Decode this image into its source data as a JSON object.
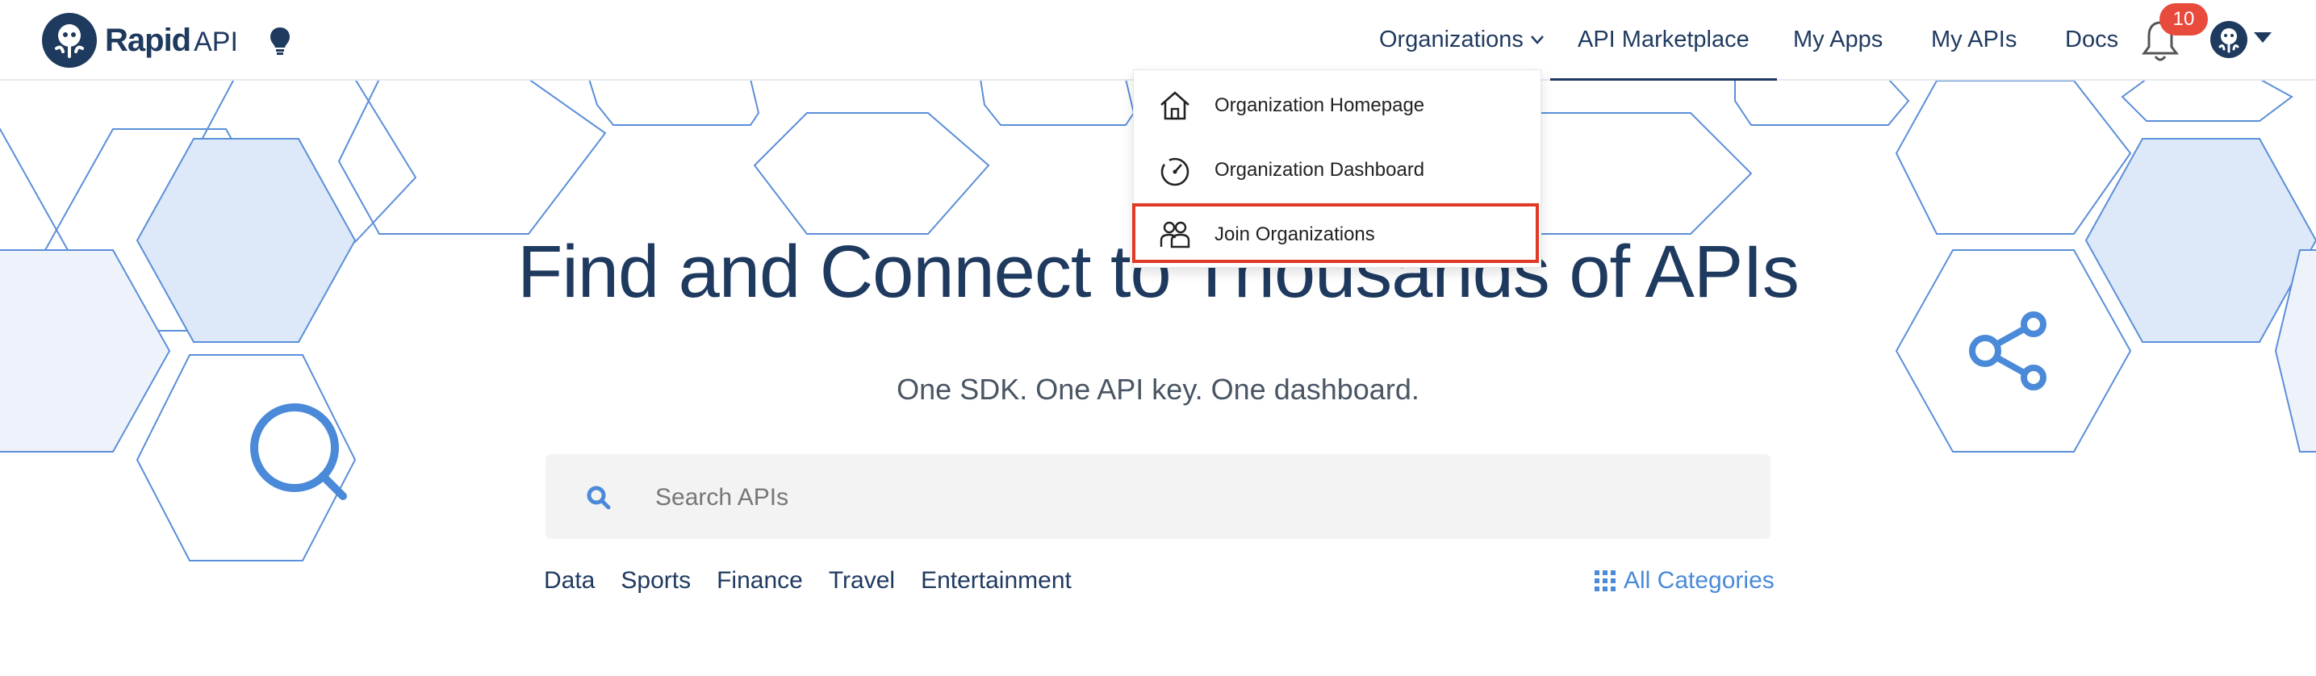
{
  "colors": {
    "brand_navy": "#1f3a5f",
    "accent_blue": "#4a8ad8",
    "hex_fill": "#dde8f8",
    "badge_red": "#e84b3c",
    "highlight_red": "#e03a24"
  },
  "header": {
    "logo_word": "Rapid",
    "logo_suffix": "API",
    "nav": {
      "organizations": "Organizations",
      "marketplace": "API Marketplace",
      "my_apps": "My Apps",
      "my_apis": "My APIs",
      "docs": "Docs"
    },
    "notification_count": "10",
    "icons": [
      "rapidapi-logo-icon",
      "lightbulb-icon",
      "chevron-down-icon",
      "bell-icon",
      "avatar-icon",
      "caret-down-icon"
    ]
  },
  "dropdown": {
    "items": [
      {
        "label": "Organization Homepage",
        "icon": "house-icon"
      },
      {
        "label": "Organization Dashboard",
        "icon": "speedometer-icon"
      },
      {
        "label": "Join Organizations",
        "icon": "people-icon",
        "highlighted": true
      }
    ]
  },
  "hero": {
    "title": "Find and Connect to Thousands of APIs",
    "subtitle": "One SDK. One API key. One dashboard.",
    "decor_icons": [
      "magnifier-icon",
      "share-icon"
    ]
  },
  "search": {
    "placeholder": "Search APIs",
    "value": ""
  },
  "categories": [
    "Data",
    "Sports",
    "Finance",
    "Travel",
    "Entertainment"
  ],
  "all_categories": "All Categories"
}
